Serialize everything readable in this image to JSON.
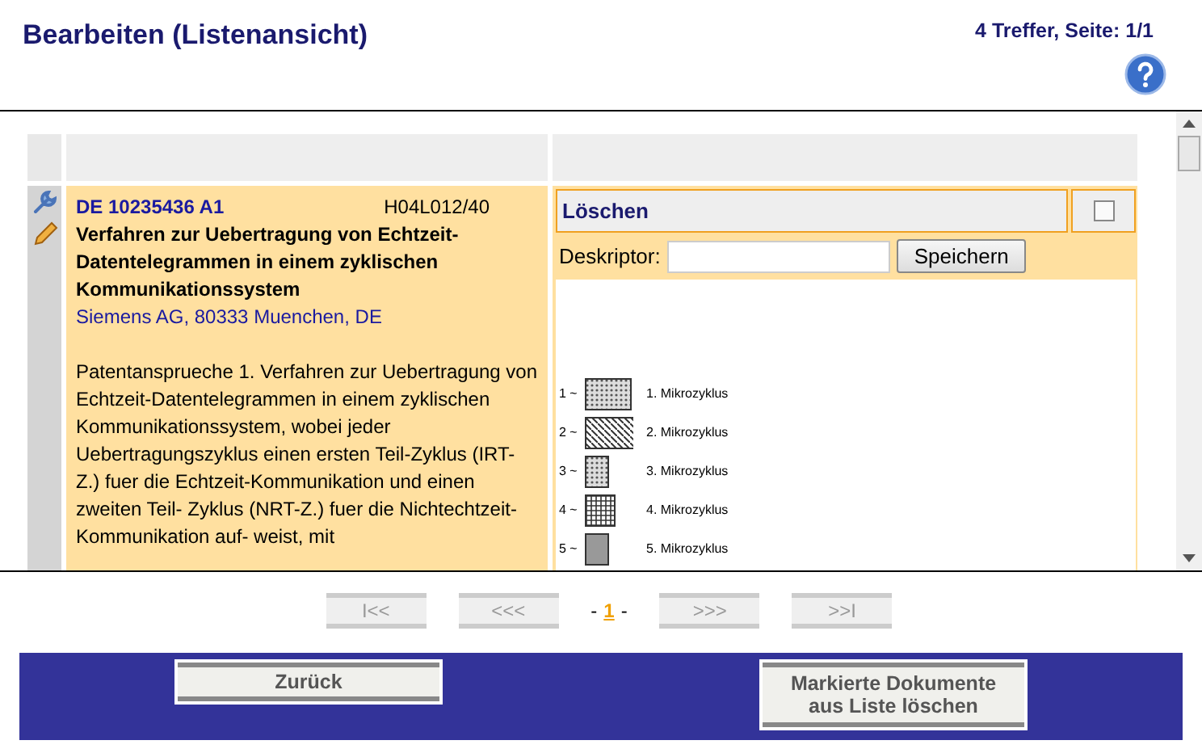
{
  "header": {
    "title": "Bearbeiten (Listenansicht)",
    "hits": "4 Treffer, Seite: 1/1"
  },
  "results": [
    {
      "number": "DE 10235436 A1",
      "classification": "H04L012/40",
      "title": "Verfahren zur Uebertragung von Echtzeit-Datentelegrammen in einem zyklischen Kommunikationssystem",
      "applicant": "Siemens AG, 80333 Muenchen, DE",
      "abstract": "Patentansprueche 1. Verfahren zur Uebertragung von Echtzeit-Datentelegrammen in einem zyklischen Kommunikationssystem, wobei jeder Uebertragungszyklus einen ersten Teil-Zyklus (IRT-Z.) fuer die Echtzeit-Kommunikation und einen zweiten Teil- Zyklus (NRT-Z.) fuer die Nichtechtzeit-Kommunikation auf- weist, mit",
      "delete_label": "Löschen",
      "delete_checked": false,
      "descriptor_label": "Deskriptor:",
      "save_button": "Speichern",
      "figure_items": [
        {
          "number": "1 ~",
          "label": "1. Mikrozyklus"
        },
        {
          "number": "2 ~",
          "label": "2. Mikrozyklus"
        },
        {
          "number": "3 ~",
          "label": "3. Mikrozyklus"
        },
        {
          "number": "4 ~",
          "label": "4. Mikrozyklus"
        },
        {
          "number": "5 ~",
          "label": "5. Mikrozyklus"
        }
      ]
    }
  ],
  "pager": {
    "buttons": [
      {
        "label": "I<<",
        "disabled": true
      },
      {
        "label": "<<<",
        "disabled": true
      },
      {
        "label": ">>>",
        "disabled": true
      },
      {
        "label": ">>I",
        "disabled": true
      }
    ],
    "page_separator": "-",
    "pages": [
      {
        "label": "1",
        "selected": true
      }
    ]
  },
  "footer": {
    "back_button": "Zurück",
    "remove_button_lines": [
      "Markierte Dokumente",
      "aus Liste löschen"
    ]
  }
}
